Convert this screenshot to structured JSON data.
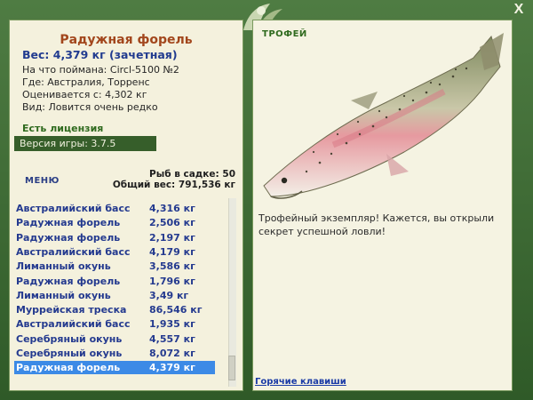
{
  "window": {
    "close_label": "X"
  },
  "details": {
    "title": "Радужная форель",
    "weight": "Вес: 4,379 кг (зачетная)",
    "caught_on": "На что поймана: Circl-5100 №2",
    "location": "Где: Австралия, Торренс",
    "value": "Оценивается с: 4,302 кг",
    "rarity": "Вид: Ловится очень редко",
    "license": "Есть лицензия",
    "version": "Версия игры: 3.7.5"
  },
  "menu": {
    "label": "МЕНЮ"
  },
  "stats": {
    "count": "Рыб в садке: 50",
    "total": "Общий вес: 791,536 кг"
  },
  "catches": [
    {
      "name": "Австралийский басс",
      "weight": "4,316 кг"
    },
    {
      "name": "Радужная форель",
      "weight": "2,506 кг"
    },
    {
      "name": "Радужная форель",
      "weight": "2,197 кг"
    },
    {
      "name": "Австралийский басс",
      "weight": "4,179 кг"
    },
    {
      "name": "Лиманный окунь",
      "weight": "3,586 кг"
    },
    {
      "name": "Радужная форель",
      "weight": "1,796 кг"
    },
    {
      "name": "Лиманный окунь",
      "weight": "3,49 кг"
    },
    {
      "name": "Муррейская треска",
      "weight": "86,546 кг"
    },
    {
      "name": "Австралийский басс",
      "weight": "1,935 кг"
    },
    {
      "name": "Серебряный окунь",
      "weight": "4,557 кг"
    },
    {
      "name": "Серебряный окунь",
      "weight": "8,072 кг"
    },
    {
      "name": "Радужная форель",
      "weight": "4,379 кг"
    }
  ],
  "selected_index": 11,
  "trophy": {
    "label": "ТРОФЕЙ",
    "message": "Трофейный экземпляр! Кажется, вы открыли секрет успешной ловли!"
  },
  "hotkeys": {
    "label": "Горячие клавиши"
  },
  "colors": {
    "frame": "#3f6a34",
    "panel": "#f4f1dd",
    "accent_blue": "#243a8f",
    "selected": "#3c8ae6"
  },
  "icons": {
    "logo": "leaf-logo-icon",
    "close": "close-icon",
    "fish": "rainbow-trout-image"
  }
}
